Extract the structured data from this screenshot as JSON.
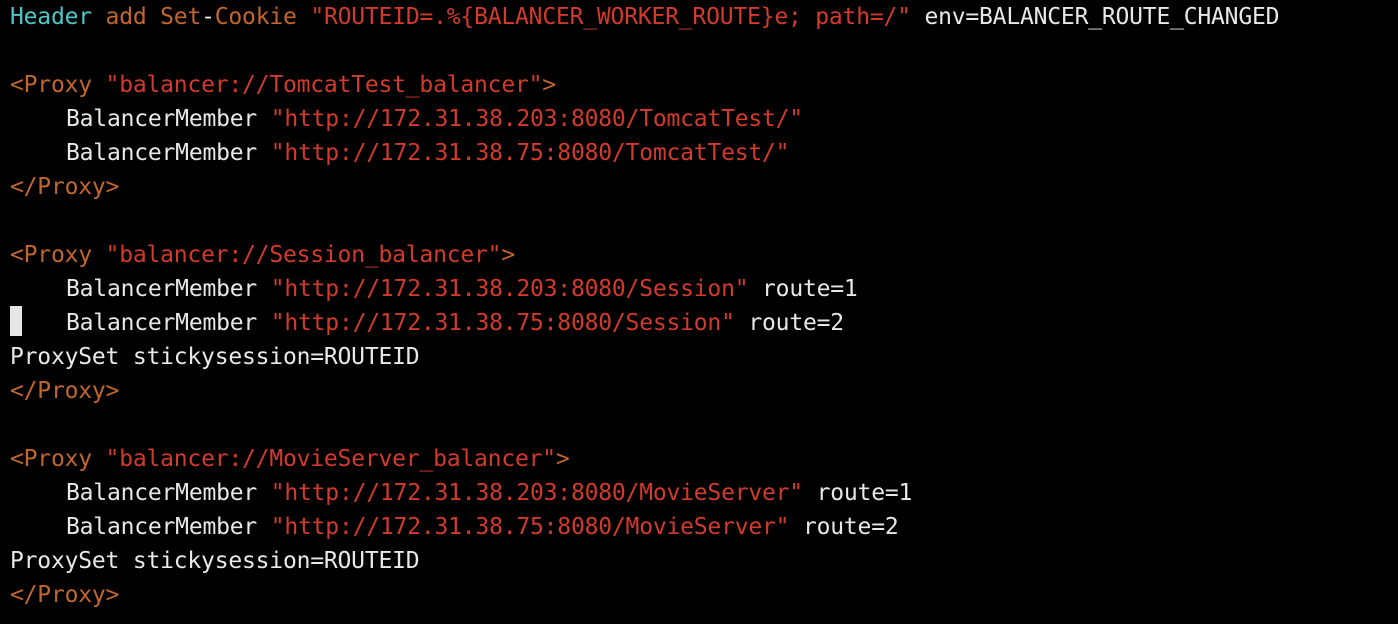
{
  "terminal": {
    "lines": {
      "l1": {
        "keyword": "Header",
        "action": "add",
        "cookie_directive": "Set",
        "dash": "-",
        "cookie_name": "Cookie",
        "value": "\"ROUTEID=.%{BALANCER_WORKER_ROUTE}e; path=/\"",
        "env": " env=BALANCER_ROUTE_CHANGED"
      },
      "l3": {
        "open": "<Proxy",
        "url": "\"balancer://TomcatTest_balancer\"",
        "close": ">"
      },
      "l4": {
        "directive": "BalancerMember",
        "url": "\"http://172.31.38.203:8080/TomcatTest/\""
      },
      "l5": {
        "directive": "BalancerMember",
        "url": "\"http://172.31.38.75:8080/TomcatTest/\""
      },
      "l6": {
        "tag": "</Proxy>"
      },
      "l8": {
        "open": "<Proxy",
        "url": "\"balancer://Session_balancer\"",
        "close": ">"
      },
      "l9": {
        "directive": "BalancerMember",
        "url": "\"http://172.31.38.203:8080/Session\"",
        "route": " route=1"
      },
      "l10": {
        "directive": "BalancerMember",
        "url": "\"http://172.31.38.75:8080/Session\"",
        "route": " route=2"
      },
      "l11": {
        "text": "ProxySet stickysession=ROUTEID"
      },
      "l12": {
        "tag": "</Proxy>"
      },
      "l14": {
        "open": "<Proxy",
        "url": "\"balancer://MovieServer_balancer\"",
        "close": ">"
      },
      "l15": {
        "directive": "BalancerMember",
        "url": "\"http://172.31.38.203:8080/MovieServer\"",
        "route": " route=1"
      },
      "l16": {
        "directive": "BalancerMember",
        "url": "\"http://172.31.38.75:8080/MovieServer\"",
        "route": " route=2"
      },
      "l17": {
        "text": "ProxySet stickysession=ROUTEID"
      },
      "l18": {
        "tag": "</Proxy>"
      }
    }
  },
  "colors": {
    "background": "#000000",
    "keyword": "#4fc6c7",
    "tag": "#c1662d",
    "string": "#d23a2c",
    "text": "#e8e8e8"
  }
}
